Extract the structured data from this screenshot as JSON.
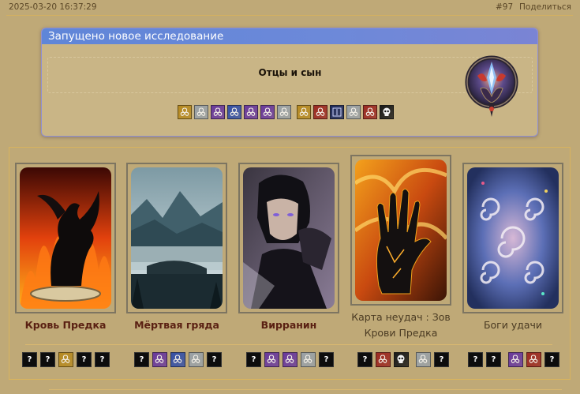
{
  "header": {
    "timestamp": "2025-03-20 16:37:29",
    "post_number": "#97",
    "share_label": "Поделиться"
  },
  "panel": {
    "title": "Запущено новое исследование",
    "research_name": "Отцы и сын",
    "emblem_icon": "crystal-sigil-emblem-icon",
    "icons": [
      {
        "name": "gold-knot-icon",
        "color": "#b68a22"
      },
      {
        "name": "silver-knot-icon",
        "color": "#9aa1a6"
      },
      {
        "name": "purple-knot-icon",
        "color": "#6a3a9c"
      },
      {
        "name": "blue-knot-icon",
        "color": "#3651a6"
      },
      {
        "name": "purple-knot-icon",
        "color": "#6a3a9c"
      },
      {
        "name": "purple-knot-icon",
        "color": "#6a3a9c"
      },
      {
        "name": "silver-knot-icon",
        "color": "#9aa1a6"
      },
      {
        "name": "gold-knot-icon",
        "color": "#b68a22"
      },
      {
        "name": "red-knot-icon",
        "color": "#9c2a22"
      },
      {
        "name": "dark-blue-book-icon",
        "color": "#1e2a5c"
      },
      {
        "name": "silver-knot-icon",
        "color": "#9aa1a6"
      },
      {
        "name": "red-knot-icon",
        "color": "#9c2a22"
      },
      {
        "name": "skull-icon",
        "color": "#1a1a1a"
      }
    ]
  },
  "cards": [
    {
      "name": "Кровь Предка",
      "art": "black-dragon-fire-art",
      "icons": [
        "?",
        "?",
        "gold-knot-icon",
        "?",
        "?"
      ]
    },
    {
      "name": "Мёртвая гряда",
      "art": "misty-mountain-lake-art",
      "icons": [
        "?",
        "purple-knot-icon",
        "blue-knot-icon",
        "silver-knot-icon",
        "?"
      ]
    },
    {
      "name": "Вирранин",
      "art": "dark-hero-portrait-art",
      "icons": [
        "?",
        "purple-knot-icon",
        "purple-knot-icon",
        "silver-knot-icon",
        "?"
      ]
    },
    {
      "name_line1": "Карта неудач : Зов",
      "name_line2": "Крови Предка",
      "art": "burning-hand-art",
      "icons": [
        "?",
        "red-knot-icon",
        "skull-icon",
        "",
        "silver-knot-icon",
        "?"
      ]
    },
    {
      "name": "Боги удачи",
      "art": "triskelion-spirals-art",
      "icons": [
        "?",
        "?",
        "",
        "purple-knot-icon",
        "red-knot-icon",
        "?"
      ]
    }
  ],
  "colors": {
    "background": "#bfa977",
    "panel_header": "#5f86d8",
    "card_name": "#5a2012",
    "accent_line": "#d9b870"
  }
}
